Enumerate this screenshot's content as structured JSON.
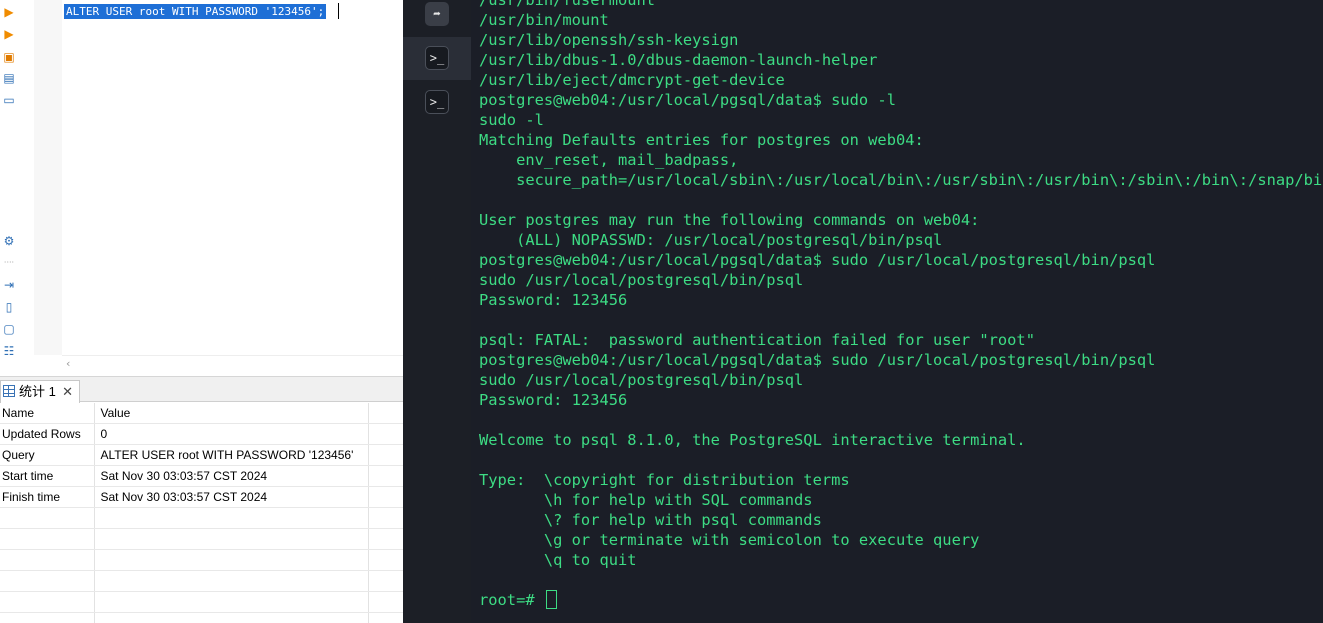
{
  "editor": {
    "sql_text": "ALTER USER root WITH PASSWORD '123456';",
    "gutter_icons": [
      "run-icon",
      "run-step-icon",
      "save-icon",
      "explain-icon",
      "terminal-icon",
      "settings-icon",
      "export-icon",
      "new-file-icon",
      "code-icon",
      "format-icon"
    ]
  },
  "results": {
    "tab_label": "统计 1",
    "columns": [
      "Name",
      "Value"
    ],
    "rows": [
      [
        "Updated Rows",
        "0"
      ],
      [
        "Query",
        "ALTER USER root WITH PASSWORD '123456'"
      ],
      [
        "Start time",
        "Sat Nov 30 03:03:57 CST 2024"
      ],
      [
        "Finish time",
        "Sat Nov 30 03:03:57 CST 2024"
      ]
    ]
  },
  "sidebar": {
    "buttons": [
      "sftp-icon",
      "terminal-icon",
      "terminal-icon"
    ]
  },
  "terminal": {
    "lines": [
      "/usr/bin/fusermount",
      "/usr/bin/mount",
      "/usr/lib/openssh/ssh-keysign",
      "/usr/lib/dbus-1.0/dbus-daemon-launch-helper",
      "/usr/lib/eject/dmcrypt-get-device",
      "postgres@web04:/usr/local/pgsql/data$ sudo -l",
      "sudo -l",
      "Matching Defaults entries for postgres on web04:",
      "    env_reset, mail_badpass,",
      "    secure_path=/usr/local/sbin\\:/usr/local/bin\\:/usr/sbin\\:/usr/bin\\:/sbin\\:/bin\\:/snap/bin",
      "",
      "User postgres may run the following commands on web04:",
      "    (ALL) NOPASSWD: /usr/local/postgresql/bin/psql",
      "postgres@web04:/usr/local/pgsql/data$ sudo /usr/local/postgresql/bin/psql",
      "sudo /usr/local/postgresql/bin/psql",
      "Password: 123456",
      "",
      "psql: FATAL:  password authentication failed for user \"root\"",
      "postgres@web04:/usr/local/pgsql/data$ sudo /usr/local/postgresql/bin/psql",
      "sudo /usr/local/postgresql/bin/psql",
      "Password: 123456",
      "",
      "Welcome to psql 8.1.0, the PostgreSQL interactive terminal.",
      "",
      "Type:  \\copyright for distribution terms",
      "       \\h for help with SQL commands",
      "       \\? for help with psql commands",
      "       \\g or terminate with semicolon to execute query",
      "       \\q to quit",
      "",
      "root=# "
    ],
    "text_color": "#3ddc84",
    "background": "#1b1e27"
  }
}
